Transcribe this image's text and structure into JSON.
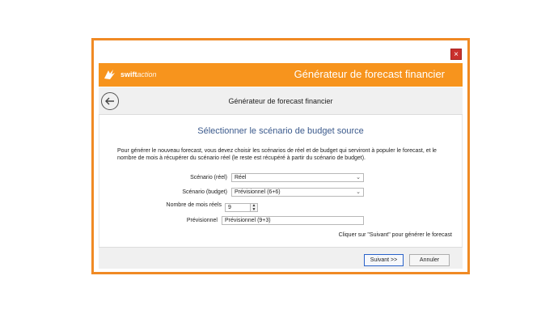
{
  "window": {
    "close_label": "×"
  },
  "brand": {
    "logo_main": "swift",
    "logo_accent": "action",
    "title": "Générateur de forecast financier"
  },
  "subheader": {
    "title": "Générateur de forecast financier"
  },
  "main": {
    "heading": "Sélectionner le scénario de budget source",
    "description": "Pour générer le nouveau forecast, vous devez choisir les scénarios de réel et de budget qui serviront à populer le forecast, et le nombre de mois à récupérer du scénario réel (le reste est récupéré à partir du scénario de budget).",
    "fields": {
      "scenario_reel": {
        "label": "Scénario (réel)",
        "value": "Réel"
      },
      "scenario_budget": {
        "label": "Scénario (budget)",
        "value": "Prévisionnel (6+6)"
      },
      "nb_mois": {
        "label": "Nombre de mois réels",
        "value": "9"
      },
      "previsionnel": {
        "label": "Prévisionnel",
        "value": "Prévisionnel (9+3)"
      }
    },
    "hint": "Cliquer sur \"Suivant\" pour générer le forecast"
  },
  "footer": {
    "next_label": "Suivant >>",
    "cancel_label": "Annuler"
  },
  "colors": {
    "brand_orange": "#f7941d",
    "frame_orange": "#f08a24",
    "heading_blue": "#3b5a8c",
    "close_red": "#c9302c"
  }
}
